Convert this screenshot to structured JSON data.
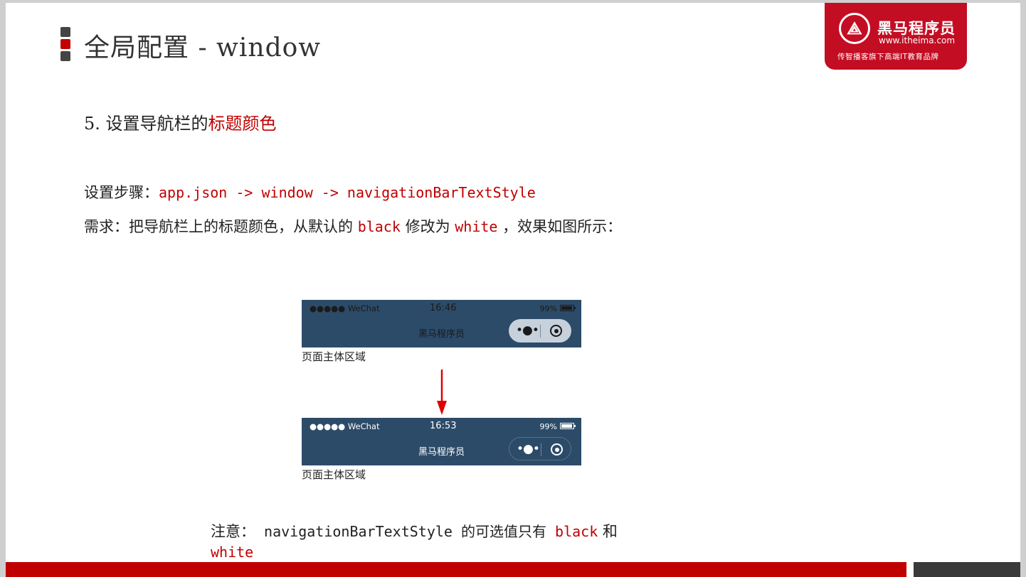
{
  "title": "全局配置 - window",
  "logo": {
    "glyph": "⟁",
    "name": "黑马程序员",
    "url": "www.itheima.com",
    "slogan": "传智播客旗下高端IT教育品牌"
  },
  "heading": {
    "prefix": "5. 设置导航栏的",
    "highlight": "标题颜色"
  },
  "steps": {
    "label": "设置步骤：",
    "path": "app.json -> window -> navigationBarTextStyle"
  },
  "requirement": {
    "p1": "需求：把导航栏上的标题颜色，从默认的 ",
    "from": "black",
    "p2": " 修改为 ",
    "to": "white",
    "p3": " ，效果如图所示："
  },
  "phone_before": {
    "carrier": "●●●●● WeChat",
    "time": "16:46",
    "battery": "99%",
    "nav_title": "黑马程序员",
    "body_text": "页面主体区域",
    "text_color": "black"
  },
  "phone_after": {
    "carrier": "●●●●● WeChat",
    "time": "16:53",
    "battery": "99%",
    "nav_title": "黑马程序员",
    "body_text": "页面主体区域",
    "text_color": "white"
  },
  "note": {
    "label": "注意：",
    "p1": " navigationBarTextStyle 的可选值只有 ",
    "opt1": "black",
    "p2": " 和 ",
    "opt2": "white"
  },
  "colors": {
    "accent": "#c00000",
    "navbar": "#2c4b68"
  }
}
